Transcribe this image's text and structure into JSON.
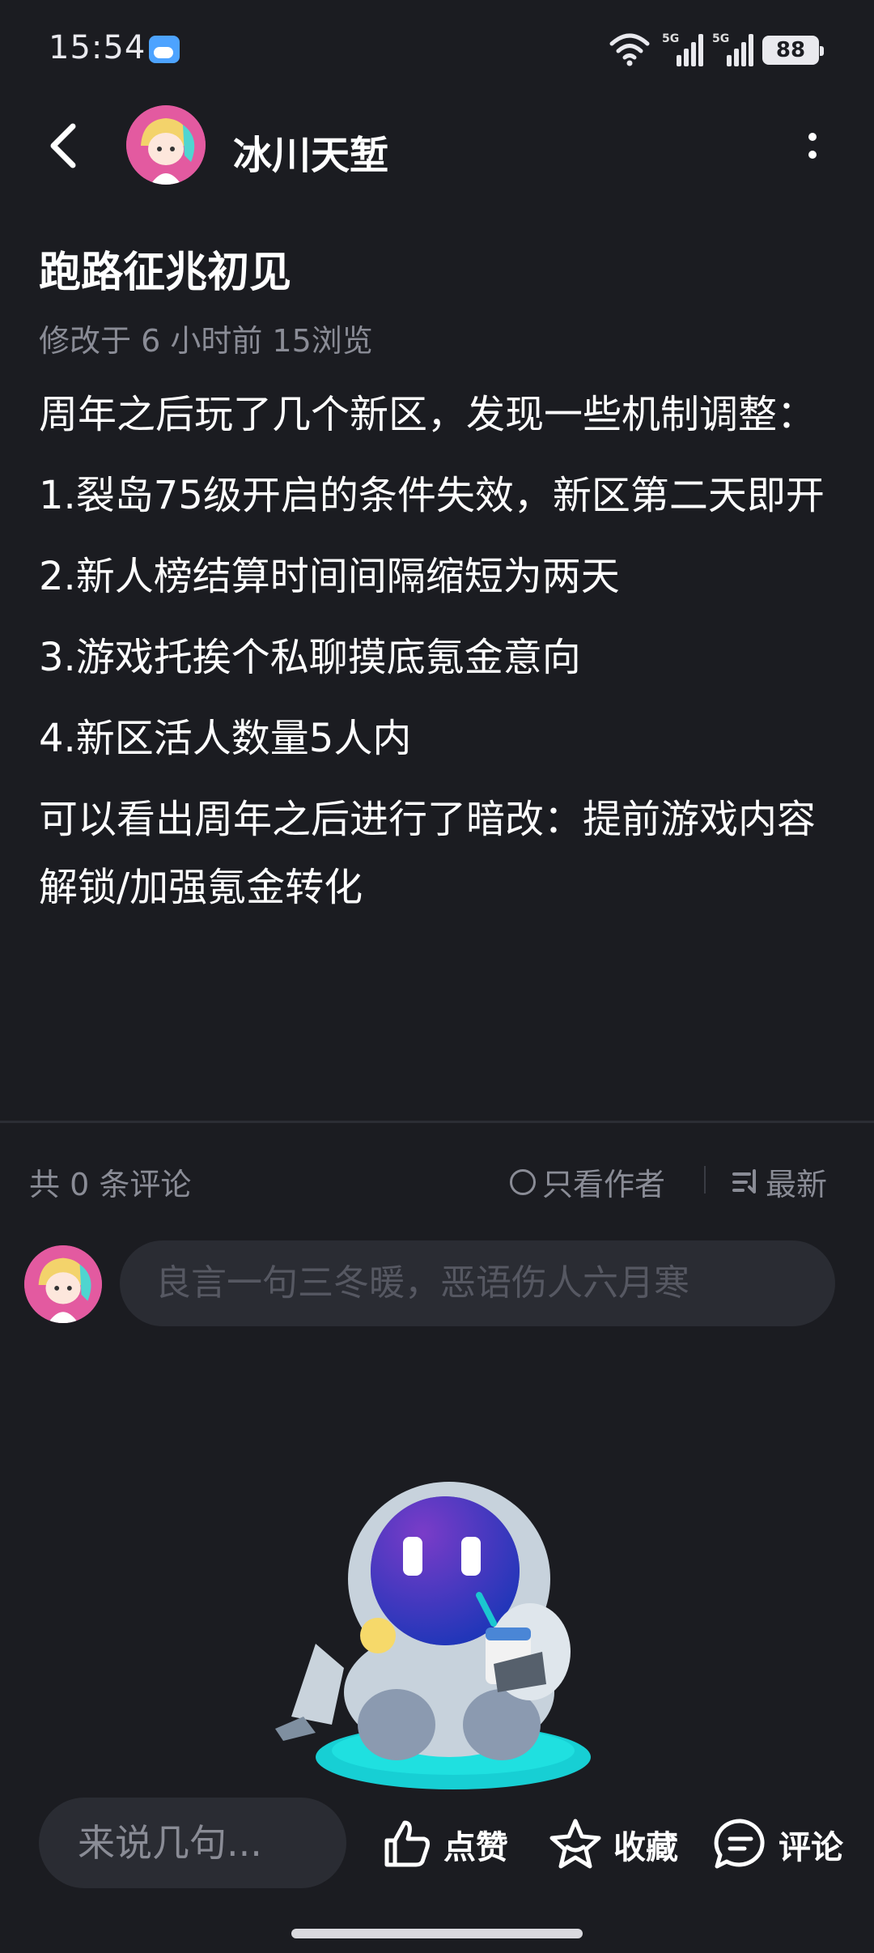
{
  "status_bar": {
    "time": "15:54",
    "network_1": "5G",
    "network_2": "5G",
    "battery": "88"
  },
  "header": {
    "author_name": "冰川天堑",
    "icons": [
      "back-arrow-icon",
      "more-vertical-icon"
    ]
  },
  "post": {
    "title": "跑路征兆初见",
    "meta": "修改于 6 小时前  15浏览",
    "paragraphs": [
      "周年之后玩了几个新区，发现一些机制调整：",
      "1.裂岛75级开启的条件失效，新区第二天即开",
      "2.新人榜结算时间间隔缩短为两天",
      "3.游戏托挨个私聊摸底氪金意向",
      "4.新区活人数量5人内",
      "可以看出周年之后进行了暗改：提前游戏内容解锁/加强氪金转化"
    ]
  },
  "comments": {
    "count_label": "共 0 条评论",
    "only_author_label": "只看作者",
    "sort_label": "最新",
    "input_placeholder": "良言一句三冬暖，恶语伤人六月寒"
  },
  "bottom_bar": {
    "input_placeholder": "来说几句...",
    "like_label": "点赞",
    "favorite_label": "收藏",
    "comment_label": "评论"
  },
  "colors": {
    "background": "#1b1c21",
    "muted_text": "#8a8c96",
    "input_bg": "#2a2c33",
    "avatar_bg": "#e35aa0"
  }
}
